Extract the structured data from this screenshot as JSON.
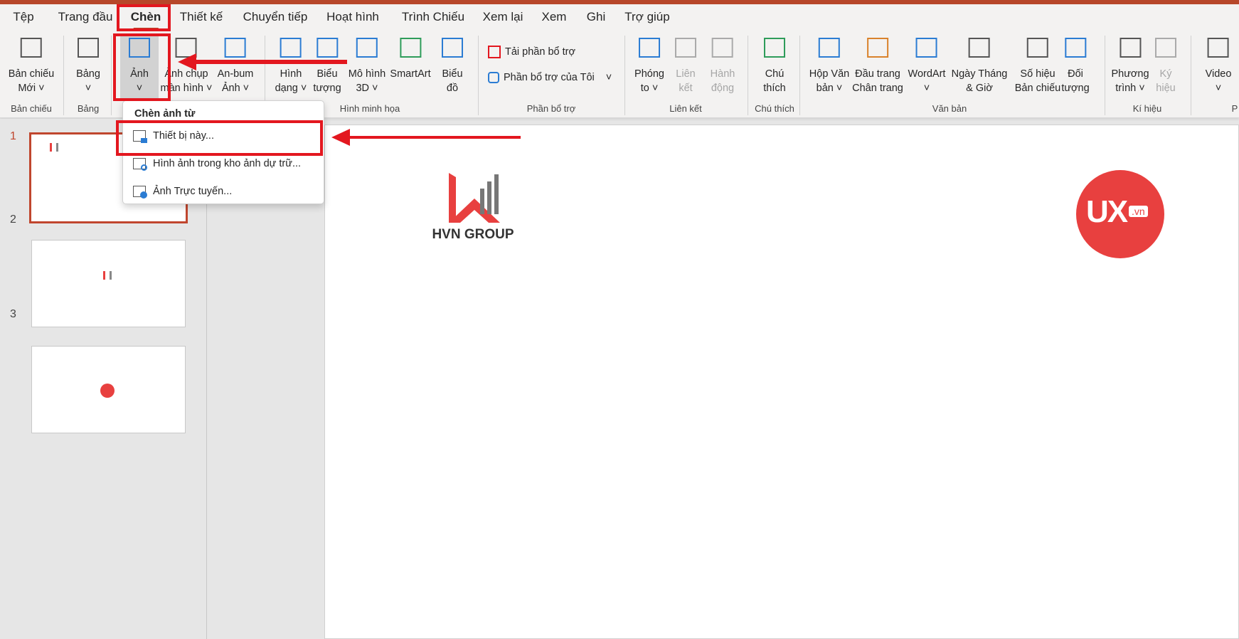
{
  "tabs": [
    "Tệp",
    "Trang đầu",
    "Chèn",
    "Thiết kế",
    "Chuyển tiếp",
    "Hoạt hình",
    "Trình Chiếu",
    "Xem lại",
    "Xem",
    "Ghi",
    "Trợ giúp"
  ],
  "active_tab": "Chèn",
  "ribbon": {
    "buttons": [
      {
        "l1": "Bản chiếu",
        "l2": "Mới ˅",
        "icon": "new-slide-icon"
      },
      {
        "l1": "Bảng",
        "l2": "˅",
        "icon": "table-icon"
      },
      {
        "l1": "Ảnh",
        "l2": "˅",
        "icon": "picture-icon"
      },
      {
        "l1": "Ảnh chụp",
        "l2": "màn hình ˅",
        "icon": "screenshot-icon"
      },
      {
        "l1": "An-bum",
        "l2": "Ảnh ˅",
        "icon": "photo-album-icon"
      },
      {
        "l1": "Hình",
        "l2": "dạng ˅",
        "icon": "shapes-icon"
      },
      {
        "l1": "Biểu",
        "l2": "tượng",
        "icon": "icons-icon"
      },
      {
        "l1": "Mô hình",
        "l2": "3D ˅",
        "icon": "3d-model-icon"
      },
      {
        "l1": "SmartArt",
        "l2": "",
        "icon": "smartart-icon"
      },
      {
        "l1": "Biểu",
        "l2": "đồ",
        "icon": "chart-icon"
      },
      {
        "l1": "Phóng",
        "l2": "to ˅",
        "icon": "zoom-icon"
      },
      {
        "l1": "Liên",
        "l2": "kết",
        "icon": "link-icon"
      },
      {
        "l1": "Hành",
        "l2": "động",
        "icon": "action-icon"
      },
      {
        "l1": "Chú",
        "l2": "thích",
        "icon": "comment-icon"
      },
      {
        "l1": "Hộp Văn",
        "l2": "bản ˅",
        "icon": "text-box-icon"
      },
      {
        "l1": "Đầu trang",
        "l2": "Chân trang",
        "icon": "header-footer-icon"
      },
      {
        "l1": "WordArt",
        "l2": "˅",
        "icon": "wordart-icon"
      },
      {
        "l1": "Ngày Tháng",
        "l2": "& Giờ",
        "icon": "date-time-icon"
      },
      {
        "l1": "Số hiệu",
        "l2": "Bản chiếu",
        "icon": "slide-number-icon"
      },
      {
        "l1": "Đối",
        "l2": "tượng",
        "icon": "object-icon"
      },
      {
        "l1": "Phương",
        "l2": "trình ˅",
        "icon": "equation-icon"
      },
      {
        "l1": "Ký",
        "l2": "hiệu",
        "icon": "symbol-icon"
      },
      {
        "l1": "Video",
        "l2": "˅",
        "icon": "video-icon"
      }
    ],
    "addins": {
      "get": "Tải phần bổ trợ",
      "mine": "Phần bổ trợ của Tôi"
    },
    "groups": [
      "Bản chiếu",
      "Bảng",
      "Hình minh họa",
      "Phần bổ trợ",
      "Liên kết",
      "Chú thích",
      "Văn bản",
      "Kí hiệu",
      "P"
    ]
  },
  "menu": {
    "header": "Chèn ảnh từ",
    "items": [
      "Thiết bị này...",
      "Hình ảnh trong kho ảnh dự trữ...",
      "Ảnh Trực tuyến..."
    ]
  },
  "slides": {
    "numbers": [
      "1",
      "2",
      "3"
    ],
    "selected": 1
  },
  "slide": {
    "logo_text": "HVN GROUP",
    "ux_logo": "UX",
    "ux_suffix": ".vn"
  },
  "colors": {
    "accent": "#b7472a",
    "highlight": "#e3171f",
    "logo_red": "#e8403f"
  }
}
